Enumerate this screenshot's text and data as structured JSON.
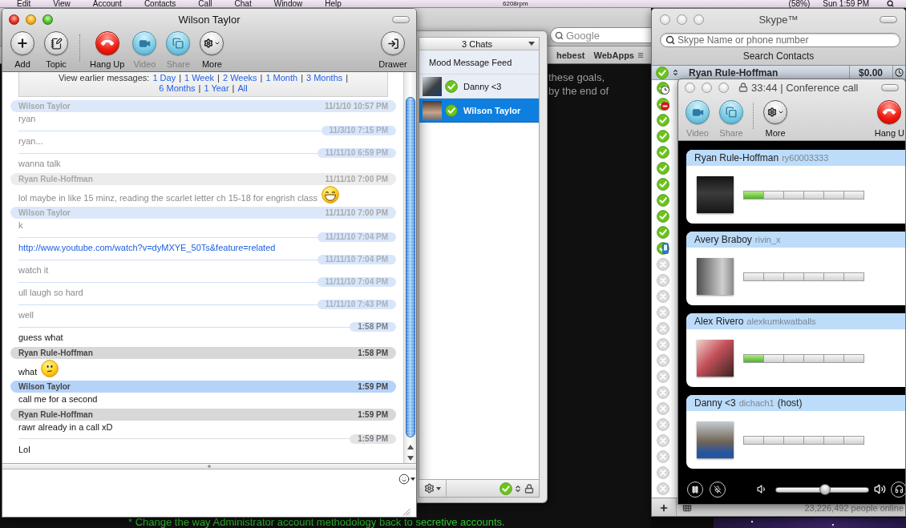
{
  "menu_bar": {
    "menus": [
      "Edit",
      "View",
      "Account",
      "Contacts",
      "Call",
      "Chat",
      "Window",
      "Help"
    ],
    "fan_speed": "6208rpm",
    "battery": "(58%)",
    "clock": "Sun 1:59 PM"
  },
  "browser": {
    "search": {
      "placeholder": "Google"
    },
    "bookmarks": [
      {
        "label": "hebest",
        "folder": false
      },
      {
        "label": "WebApps",
        "folder": true
      }
    ],
    "page_text": [
      "these goals,",
      "by the end of"
    ],
    "footer_note": "* Change the way Administrator account methodology back to secretive accounts."
  },
  "chat_window": {
    "title": "Wilson Taylor",
    "active": true,
    "toolbar_groups": [
      [
        {
          "kind": "add",
          "label": "Add",
          "disabled": false
        },
        {
          "kind": "topic",
          "label": "Topic",
          "disabled": false
        }
      ],
      [
        {
          "kind": "hangup",
          "label": "Hang Up",
          "disabled": false
        },
        {
          "kind": "video",
          "label": "Video",
          "disabled": true
        },
        {
          "kind": "share",
          "label": "Share",
          "disabled": true
        },
        {
          "kind": "more",
          "label": "More",
          "disabled": false
        }
      ]
    ],
    "end_button": {
      "kind": "drawer",
      "label": "Drawer",
      "disabled": false
    },
    "earlier_messages": {
      "label": "View earlier messages:",
      "separator": "|",
      "link_rows": [
        [
          "1 Day",
          "1 Week",
          "2 Weeks",
          "1 Month",
          "3 Months"
        ],
        [
          "6 Months",
          "1 Year",
          "All"
        ]
      ]
    },
    "messages": [
      {
        "sender": "Wilson Taylor",
        "time": "11/1/10 10:57 PM",
        "from_self": false,
        "dimmed": true,
        "text": "ryan",
        "link": false
      },
      {
        "time": "11/3/10 7:15 PM",
        "from_self": false,
        "dimmed": true,
        "text": "ryan...",
        "link": false
      },
      {
        "time": "11/11/10 6:59 PM",
        "from_self": false,
        "dimmed": true,
        "text": "wanna talk",
        "link": false
      },
      {
        "sender": "Ryan Rule-Hoffman",
        "time": "11/11/10 7:00 PM",
        "from_self": true,
        "dimmed": true,
        "text": "lol maybe in like 15 minz, reading the scarlet letter ch 15-18 for engrish class",
        "link": false,
        "emoticon": {
          "kind": "grin"
        }
      },
      {
        "sender": "Wilson Taylor",
        "time": "11/11/10 7:00 PM",
        "from_self": false,
        "dimmed": true,
        "text": "k",
        "link": false
      },
      {
        "time": "11/11/10 7:04 PM",
        "from_self": false,
        "dimmed": true,
        "text": "http://www.youtube.com/watch?v=dyMXYE_50Ts&feature=related",
        "link": true
      },
      {
        "time": "11/11/10 7:04 PM",
        "from_self": false,
        "dimmed": true,
        "text": "watch it",
        "link": false
      },
      {
        "time": "11/11/10 7:04 PM",
        "from_self": false,
        "dimmed": true,
        "text": "ull laugh so hard",
        "link": false
      },
      {
        "time": "11/11/10 7:43 PM",
        "from_self": false,
        "dimmed": true,
        "text": "well",
        "link": false
      },
      {
        "time": "1:58 PM",
        "from_self": false,
        "dimmed": false,
        "text": "guess what",
        "link": false
      },
      {
        "sender": "Ryan Rule-Hoffman",
        "time": "1:58 PM",
        "from_self": true,
        "dimmed": false,
        "text": "what",
        "link": false,
        "emoticon": {
          "kind": "puzzled"
        }
      },
      {
        "sender": "Wilson Taylor",
        "time": "1:59 PM",
        "from_self": false,
        "dimmed": false,
        "text": "call me for a second",
        "link": false
      },
      {
        "sender": "Ryan Rule-Hoffman",
        "time": "1:59 PM",
        "from_self": true,
        "dimmed": false,
        "text": "rawr already in a call xD",
        "link": false
      },
      {
        "time": "1:59 PM",
        "from_self": true,
        "dimmed": false,
        "text": "Lol",
        "link": false
      }
    ]
  },
  "chats_drawer": {
    "title": "3 Chats",
    "items": [
      {
        "kind": "feed",
        "name": "Mood Message Feed",
        "selected": false
      },
      {
        "kind": "contact",
        "name": "Danny <3",
        "status": {
          "kind": "online"
        },
        "selected": false
      },
      {
        "kind": "contact",
        "name": "Wilson Taylor",
        "status": {
          "kind": "online"
        },
        "selected": true
      }
    ],
    "my_status": {
      "kind": "online"
    }
  },
  "skype": {
    "title": "Skype™",
    "active": false,
    "search": {
      "placeholder": "Skype Name or phone number"
    },
    "search_label": "Search Contacts",
    "account": {
      "name": "Ryan Rule-Hoffman",
      "status": {
        "kind": "online"
      },
      "credit": "$0.00"
    },
    "contacts": [
      {
        "kind": "away"
      },
      {
        "kind": "dnd"
      },
      {
        "kind": "online"
      },
      {
        "kind": "online"
      },
      {
        "kind": "online"
      },
      {
        "kind": "online"
      },
      {
        "kind": "online"
      },
      {
        "kind": "online"
      },
      {
        "kind": "online"
      },
      {
        "kind": "online"
      },
      {
        "kind": "mobile"
      },
      {
        "kind": "offline"
      },
      {
        "kind": "offline"
      },
      {
        "kind": "offline"
      },
      {
        "kind": "offline"
      },
      {
        "kind": "offline"
      },
      {
        "kind": "offline"
      },
      {
        "kind": "offline"
      },
      {
        "kind": "offline"
      },
      {
        "kind": "offline"
      },
      {
        "kind": "offline"
      },
      {
        "kind": "offline"
      },
      {
        "kind": "offline"
      },
      {
        "kind": "offline"
      },
      {
        "kind": "offline"
      },
      {
        "kind": "offline"
      }
    ],
    "online_count": "23,226,492 people online"
  },
  "conference": {
    "title": "33:44 | Conference call",
    "active": false,
    "toolbar_groups": [
      [
        {
          "kind": "video",
          "label": "Video",
          "disabled": true
        },
        {
          "kind": "share",
          "label": "Share",
          "disabled": true
        }
      ],
      [
        {
          "kind": "more",
          "label": "More",
          "disabled": false
        }
      ]
    ],
    "end_button": {
      "kind": "hangup",
      "label": "Hang U",
      "disabled": false
    },
    "participants": [
      {
        "name": "Ryan Rule-Hoffman",
        "handle": "ry60003333",
        "level": 0.17
      },
      {
        "name": "Avery Braboy",
        "handle": "rivin_x"
      },
      {
        "name": "Alex Rivero",
        "handle": "alexkumkwatballs",
        "level": 0.17
      },
      {
        "name": "Danny <3",
        "handle": "dichach1",
        "note": "(host)"
      }
    ],
    "volume": {
      "level": 0.53
    }
  }
}
